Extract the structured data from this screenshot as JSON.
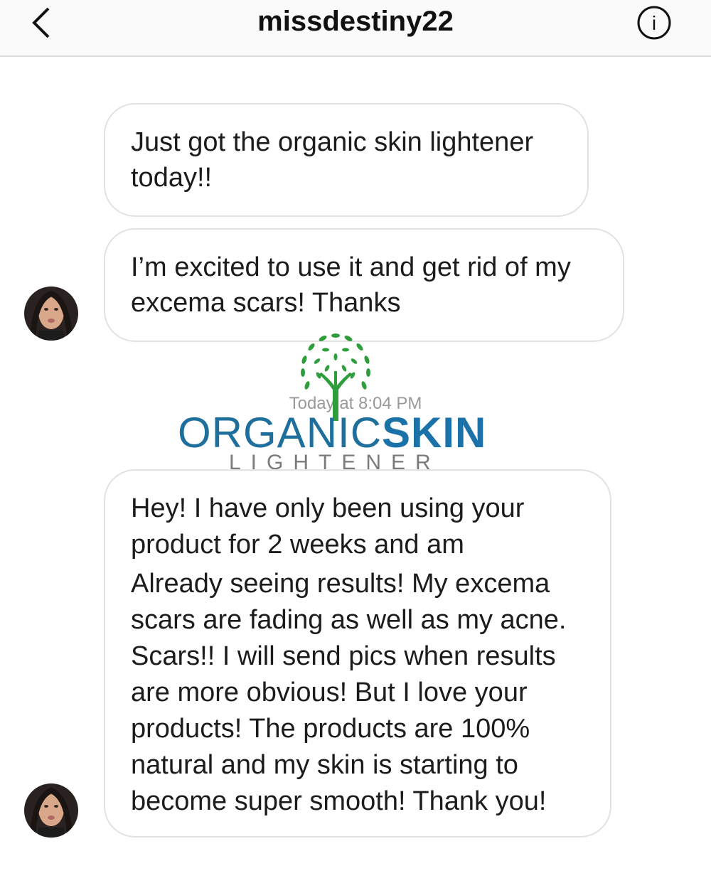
{
  "header": {
    "title": "missdestiny22",
    "back_icon": "chevron-left-icon",
    "info_icon": "info-icon",
    "info_glyph": "i"
  },
  "messages": [
    {
      "lines": [
        "Just got the organic skin lightener",
        "today!!"
      ]
    },
    {
      "lines": [
        "I’m excited to use it and get rid of my",
        "excema scars! Thanks"
      ]
    },
    {
      "lines": [
        "Hey! I have only been using your",
        "product for 2 weeks and am",
        "Already seeing results! My excema",
        "scars are fading as well as my acne.",
        "Scars!! I will send pics when results",
        "are more obvious! But I love your",
        "products! The products are 100%",
        "natural and my skin is starting to",
        "become super smooth! Thank you!"
      ]
    }
  ],
  "timestamp": "Today at 8:04 PM",
  "watermark": {
    "line1_regular": "ORGANIC",
    "line1_bold": "SKIN",
    "line2": "LIGHTENER",
    "tree_color": "#2e9e3c",
    "text_color": "#1f6f9c"
  }
}
